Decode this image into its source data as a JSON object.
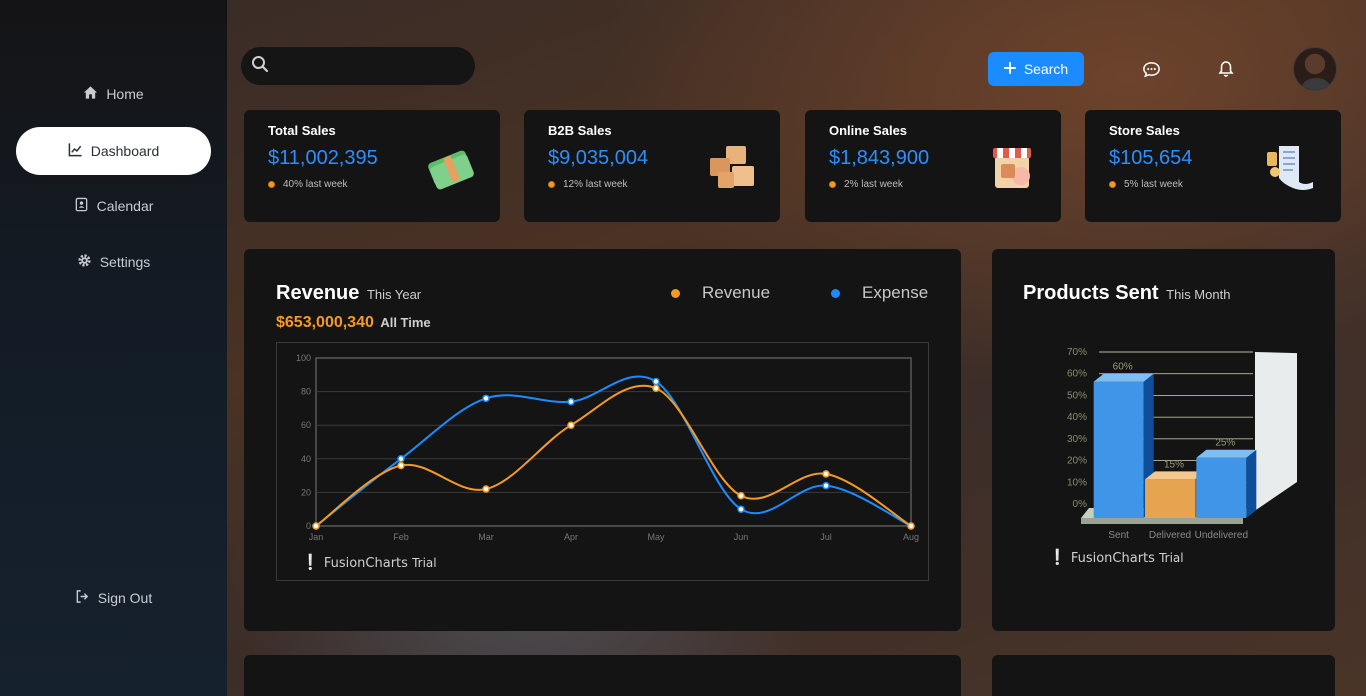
{
  "sidebar": {
    "items": [
      {
        "label": "Home",
        "icon": "home-icon"
      },
      {
        "label": "Dashboard",
        "icon": "chart-line-icon",
        "active": true
      },
      {
        "label": "Calendar",
        "icon": "address-book-icon"
      },
      {
        "label": "Settings",
        "icon": "gear-icon"
      }
    ],
    "signout": {
      "label": "Sign Out",
      "icon": "sign-out-icon"
    }
  },
  "header": {
    "search_placeholder": "",
    "search_button_label": "Search",
    "icons": [
      "chat-icon",
      "bell-icon"
    ],
    "accent": "#1a8cff"
  },
  "stats": [
    {
      "title": "Total Sales",
      "value": "$11,002,395",
      "sub": "40% last week",
      "art": "cash-stack-icon"
    },
    {
      "title": "B2B Sales",
      "value": "$9,035,004",
      "sub": "12% last week",
      "art": "boxes-icon"
    },
    {
      "title": "Online Sales",
      "value": "$1,843,900",
      "sub": "2% last week",
      "art": "online-store-icon"
    },
    {
      "title": "Store Sales",
      "value": "$105,654",
      "sub": "5% last week",
      "art": "receipt-icon"
    }
  ],
  "revenue_panel": {
    "title": "Revenue",
    "subtitle": "This Year",
    "total": "$653,000,340",
    "total_label": "All Time",
    "legend": [
      {
        "name": "Revenue",
        "color": "#f59a23"
      },
      {
        "name": "Expense",
        "color": "#1a8cff"
      }
    ],
    "watermark": "FusionCharts",
    "watermark_trial": "Trial"
  },
  "products_panel": {
    "title": "Products Sent",
    "subtitle": "This Month",
    "watermark": "FusionCharts",
    "watermark_trial": "Trial"
  },
  "chart_data": [
    {
      "type": "line",
      "categories": [
        "Jan",
        "Feb",
        "Mar",
        "Apr",
        "May",
        "Jun",
        "Jul",
        "Aug"
      ],
      "series": [
        {
          "name": "Revenue",
          "color": "#f59a23",
          "values": [
            0,
            36,
            22,
            60,
            82,
            18,
            31,
            0
          ]
        },
        {
          "name": "Expense",
          "color": "#1a8cff",
          "values": [
            0,
            40,
            76,
            74,
            86,
            10,
            24,
            0
          ]
        }
      ],
      "yticks": [
        0,
        20,
        40,
        60,
        80,
        100
      ],
      "ylim": [
        0,
        100
      ],
      "grid": true
    },
    {
      "type": "bar",
      "categories": [
        "Sent",
        "Delivered",
        "Undelivered"
      ],
      "values": [
        60,
        15,
        25
      ],
      "labels": [
        "60%",
        "15%",
        "25%"
      ],
      "colors": [
        "#3f8fe0",
        "#e6a24c",
        "#3f8fe0"
      ],
      "yticks": [
        "0%",
        "10%",
        "20%",
        "30%",
        "40%",
        "50%",
        "60%",
        "70%"
      ],
      "ylim": [
        0,
        70
      ],
      "grid": true
    }
  ]
}
